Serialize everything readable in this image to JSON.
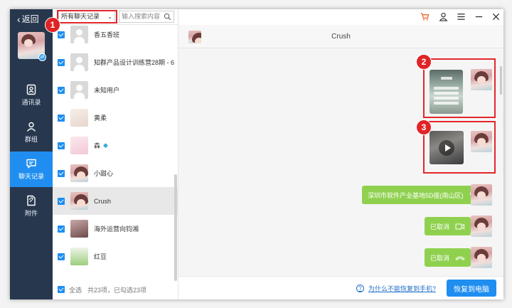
{
  "sidebar": {
    "back_label": "返回",
    "nav": [
      {
        "label": "通讯录",
        "icon": "contacts-icon"
      },
      {
        "label": "群组",
        "icon": "group-icon"
      },
      {
        "label": "聊天记录",
        "icon": "chat-icon",
        "active": true
      },
      {
        "label": "附件",
        "icon": "attachment-icon"
      }
    ]
  },
  "list": {
    "filter_value": "所有聊天记录",
    "search_placeholder": "输入搜索内容",
    "rows": [
      {
        "name": "香五香班"
      },
      {
        "name": "知群产品设计训练营28期 - 6"
      },
      {
        "name": "未知用户"
      },
      {
        "name": "黄柔"
      },
      {
        "name": "森"
      },
      {
        "name": "小甜心"
      },
      {
        "name": "Crush"
      },
      {
        "name": "海外运营向钧湘"
      },
      {
        "name": "红豆"
      }
    ],
    "footer": {
      "select_all": "全选",
      "count_text": "共23项，已勾选23项"
    }
  },
  "chat": {
    "title": "Crush",
    "location_text": "深圳市软件产业基地5D座(南山区)",
    "cancelled_1": "已取消",
    "cancelled_2": "已取消",
    "help_text": "为什么不能恢复到手机?",
    "restore_button": "恢复到电脑"
  },
  "annotations": {
    "m1": "1",
    "m2": "2",
    "m3": "3"
  },
  "colors": {
    "accent": "#1f8ef0",
    "sidebar": "#27384e",
    "bubble": "#8fd14f",
    "callout": "#e3262b"
  }
}
